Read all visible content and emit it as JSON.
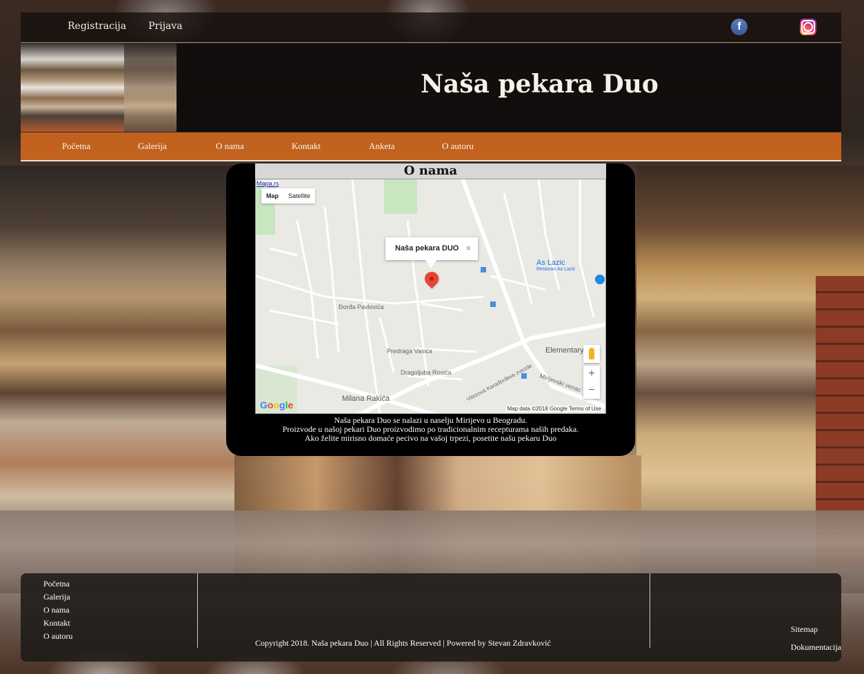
{
  "topbar": {
    "registration": "Registracija",
    "login": "Prijava",
    "facebook_icon": "facebook-icon",
    "instagram_icon": "instagram-icon"
  },
  "header": {
    "title": "Naša pekara Duo"
  },
  "nav": {
    "items": [
      {
        "label": "Početna"
      },
      {
        "label": "Galerija"
      },
      {
        "label": "O nama"
      },
      {
        "label": "Kontakt"
      },
      {
        "label": "Anketa"
      },
      {
        "label": "O autoru"
      }
    ]
  },
  "about": {
    "title": "O nama",
    "map": {
      "link": "Mapa.rs",
      "type_map": "Map",
      "type_satellite": "Satellite",
      "marker_title": "Naša pekara DUO",
      "close": "×",
      "poi_name": "As Lazic",
      "poi_sub": "Restoran As Lazić",
      "attribution": "Map data ©2018 Google   Terms of Use",
      "zoom_in": "+",
      "zoom_out": "−",
      "streets": {
        "s1": "Đorđa Pavlovića",
        "s2": "Predraga Vasića",
        "s3": "Dragoljuba Rosića",
        "s4": "Milana Rakića",
        "s5": "Vitezova Karađorđeve zvezde",
        "s6": "Mirijevski venac",
        "s7": "Elementary"
      }
    },
    "description": [
      "Naša pekara Duo se nalazi u naselju Mirijevo u Beogradu.",
      "Proizvode u našoj pekari Duo proizvodimo po tradicionalnim recepturama naših predaka.",
      "Ako želite mirisno domaće pecivo na vašoj trpezi, posetite našu pekaru Duo"
    ]
  },
  "footer": {
    "links": [
      {
        "label": "Početna"
      },
      {
        "label": "Galerija"
      },
      {
        "label": "O nama"
      },
      {
        "label": "Kontakt"
      },
      {
        "label": "O autoru"
      }
    ],
    "copyright": "Copyright 2018. Naša pekara Duo | All Rights Reserved | Powered by Stevan Zdravković",
    "sitemap": "Sitemap",
    "documentation": "Dokumentacija"
  },
  "colors": {
    "nav_orange": "#cb661e",
    "marker_red": "#ea4335"
  }
}
